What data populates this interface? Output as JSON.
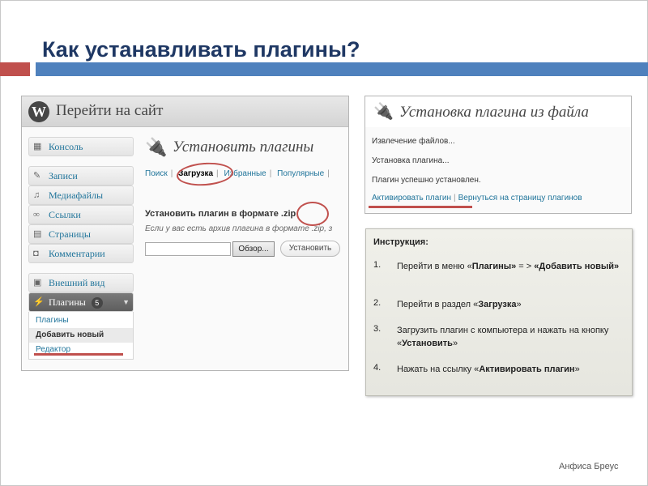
{
  "slide": {
    "title": "Как устанавливать плагины?",
    "author": "Анфиса Бреус"
  },
  "wp_admin": {
    "site_link": "Перейти на сайт",
    "menu": {
      "dashboard": "Консоль",
      "posts": "Записи",
      "media": "Медиафайлы",
      "links": "Ссылки",
      "pages": "Страницы",
      "comments": "Комментарии",
      "appearance": "Внешний вид",
      "plugins": "Плагины",
      "plugins_badge": "5",
      "sub": {
        "plugins": "Плагины",
        "add_new": "Добавить новый",
        "editor": "Редактор"
      }
    },
    "page_heading": "Установить плагины",
    "tabs": {
      "search": "Поиск",
      "upload": "Загрузка",
      "featured": "Избранные",
      "popular": "Популярные"
    },
    "upload_heading": "Установить плагин в формате .zip",
    "upload_desc": "Если у вас есть архив плагина в формате .zip, з",
    "browse_button": "Обзор...",
    "install_button": "Установить"
  },
  "install_result": {
    "title": "Установка плагина из файла",
    "lines": [
      "Извлечение файлов...",
      "Установка плагина...",
      "Плагин успешно установлен."
    ],
    "activate_link": "Активировать плагин",
    "return_link": "Вернуться на страницу плагинов"
  },
  "instructions": {
    "title": "Инструкция:",
    "steps": [
      {
        "num": "1.",
        "pre": "Перейти в меню «",
        "b1": "Плагины»",
        "mid": " = > ",
        "b2": "«Добавить новый»",
        "post": ""
      },
      {
        "num": "2.",
        "pre": "Перейти в раздел «",
        "b1": "Загрузка",
        "mid": "",
        "b2": "",
        "post": "»"
      },
      {
        "num": "3.",
        "pre": "Загрузить плагин с компьютера и нажать на кнопку «",
        "b1": "Установить",
        "mid": "",
        "b2": "",
        "post": "»"
      },
      {
        "num": "4.",
        "pre": "Нажать на ссылку «",
        "b1": "Активировать плагин",
        "mid": "",
        "b2": "",
        "post": "»"
      }
    ]
  },
  "colors": {
    "title": "#1f3864",
    "accent_red": "#c0504d",
    "accent_blue": "#4f81bd",
    "wp_link": "#21759b"
  }
}
